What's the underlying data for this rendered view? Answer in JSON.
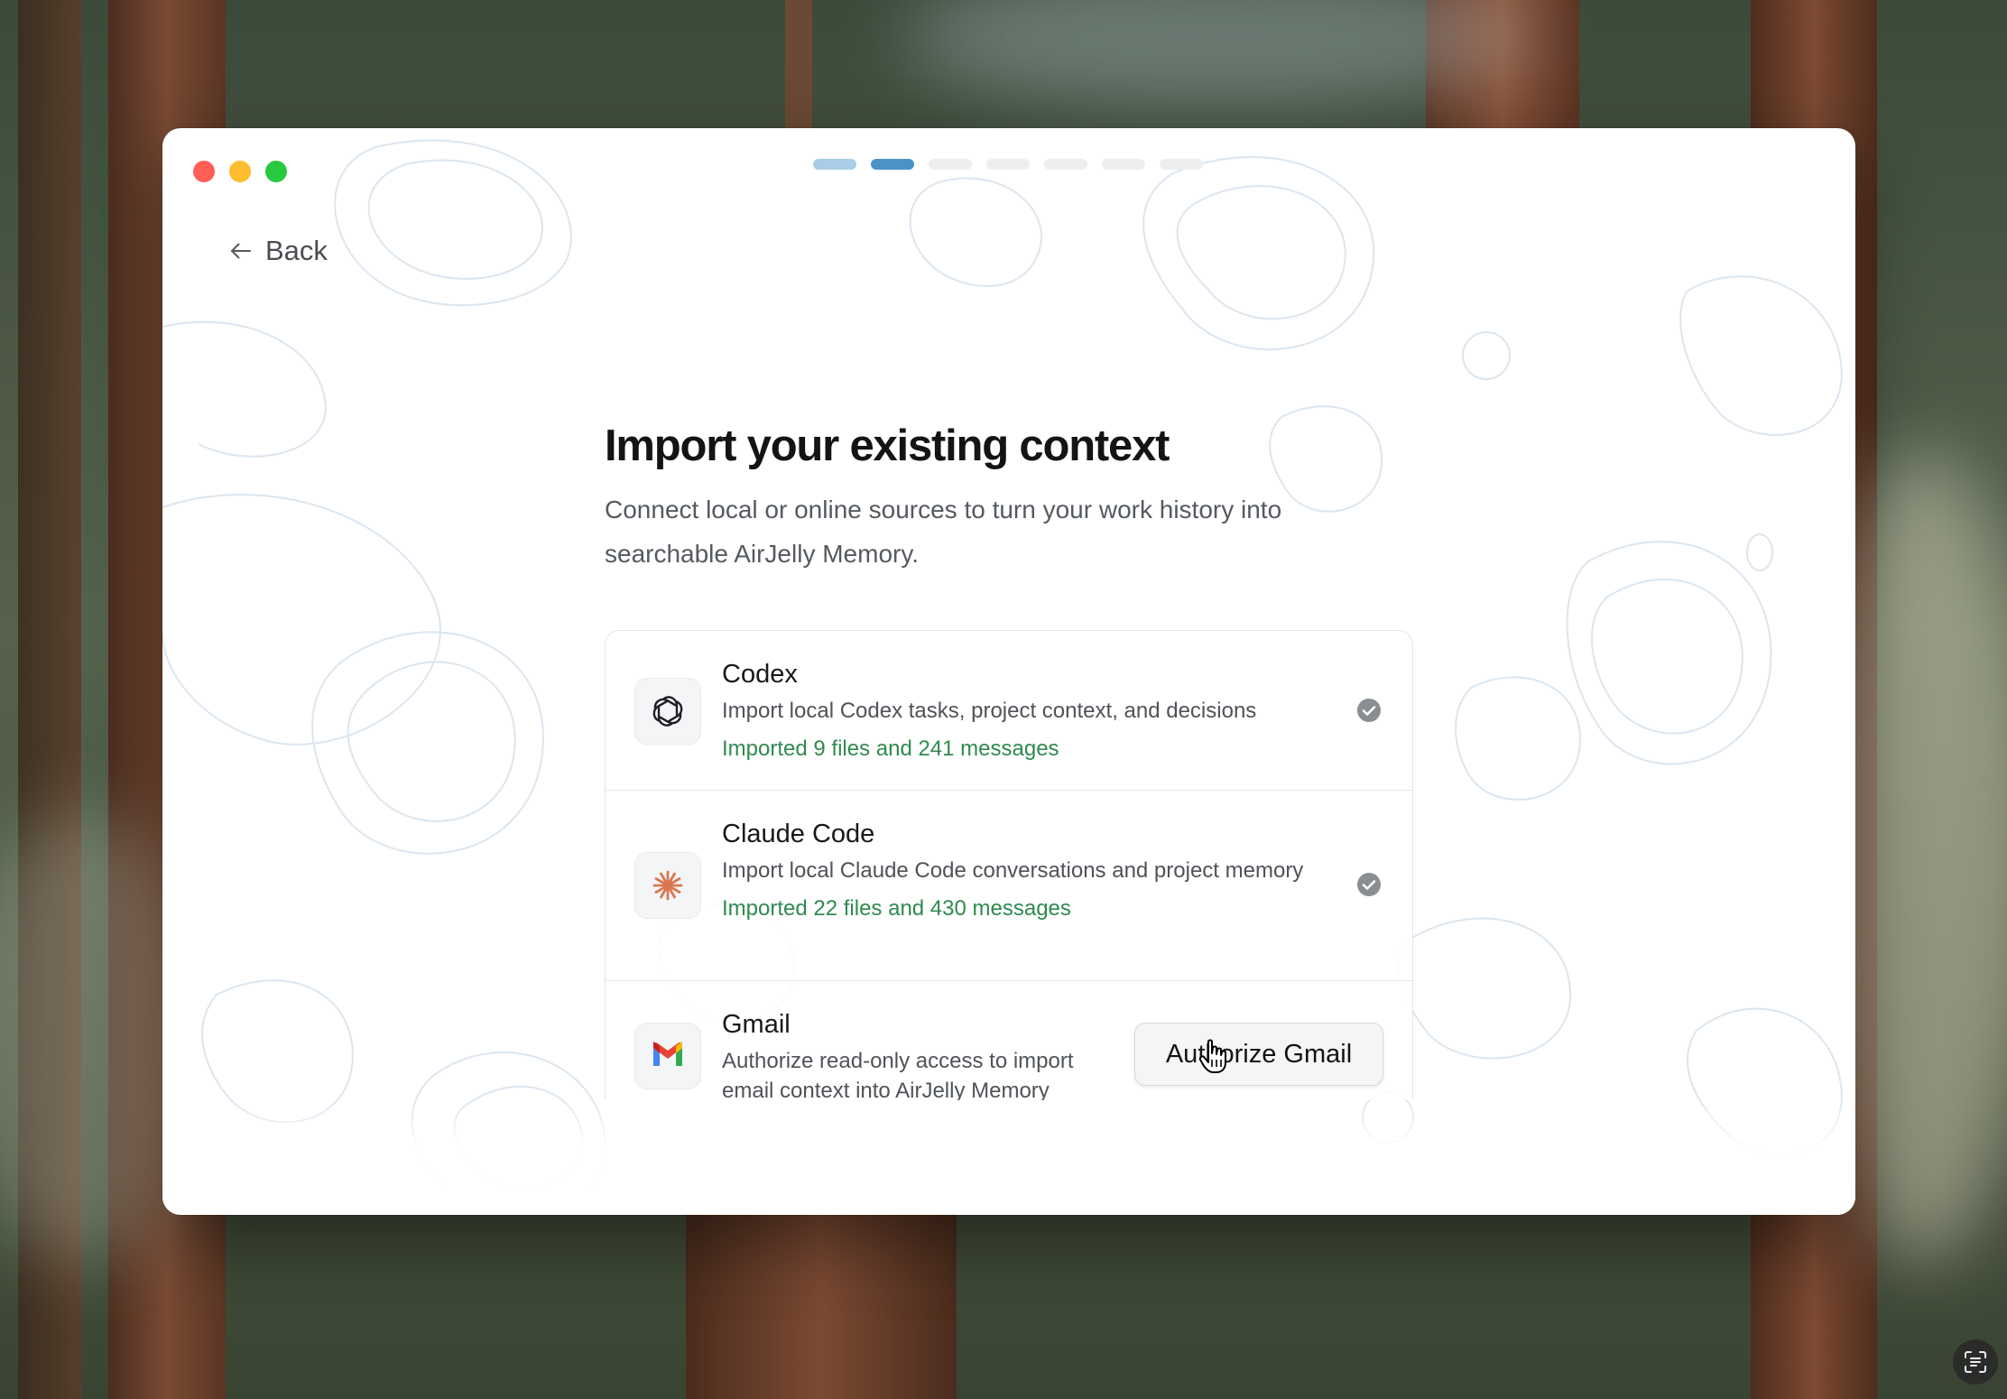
{
  "window": {
    "progress_steps": [
      {
        "state": "done",
        "color": "#a9cde6"
      },
      {
        "state": "current",
        "color": "#4a93c7"
      },
      {
        "state": "pending",
        "color": "#eceef0"
      },
      {
        "state": "pending",
        "color": "#eceef0"
      },
      {
        "state": "pending",
        "color": "#eceef0"
      },
      {
        "state": "pending",
        "color": "#eceef0"
      },
      {
        "state": "pending",
        "color": "#eceef0"
      }
    ],
    "traffic_lights": {
      "close": "#ff5f57",
      "minimize": "#febc2e",
      "zoom": "#28c840"
    }
  },
  "nav": {
    "back_label": "Back",
    "back_icon": "arrow-left-icon"
  },
  "header": {
    "title": "Import your existing context",
    "subtitle": "Connect local or online sources to turn your work history into searchable AirJelly Memory."
  },
  "sources": [
    {
      "name": "Codex",
      "description": "Import local Codex tasks, project context, and decisions",
      "status": "Imported 9 files and 241 messages",
      "icon": "openai-icon",
      "state": "imported"
    },
    {
      "name": "Claude Code",
      "description": "Import local Claude Code conversations and project memory",
      "status": "Imported 22 files and 430 messages",
      "icon": "claude-icon",
      "state": "imported"
    },
    {
      "name": "Gmail",
      "description": "Authorize read-only access to import email context into AirJelly Memory",
      "action_label": "Authorize Gmail",
      "icon": "gmail-icon",
      "state": "not-connected"
    }
  ],
  "colors": {
    "status_success": "#2f8a4f",
    "check_badge": "#8a8d91",
    "claude_accent": "#d9774f",
    "topo_line": "#dbe6f0"
  }
}
